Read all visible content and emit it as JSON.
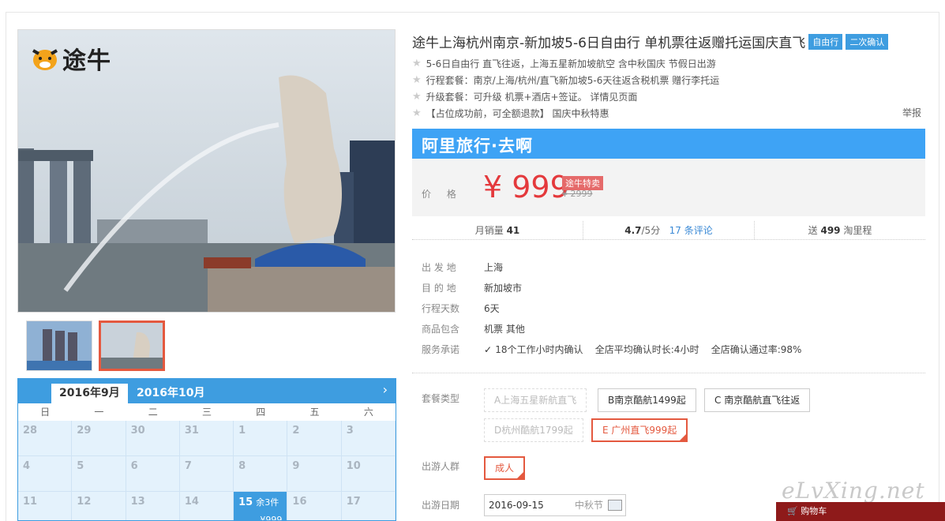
{
  "logo": {
    "text": "途牛"
  },
  "title": {
    "text": "途牛上海杭州南京-新加坡5-6日自由行 单机票往返赠托运国庆直飞",
    "badges": [
      "自由行",
      "二次确认"
    ]
  },
  "features": [
    "5-6日自由行 直飞往返，上海五星新加坡航空 含中秋国庆 节假日出游",
    "行程套餐：南京/上海/杭州/直飞新加坡5-6天往返含税机票 赠行李托运",
    "升级套餐：可升级 机票+酒店+签证。 详情见页面",
    "【占位成功前，可全额退款】 国庆中秋特惠"
  ],
  "report": "举报",
  "banner": "阿里旅行·去啊",
  "price": {
    "label": "价 格",
    "value": "¥ 999",
    "tag": "途牛特卖",
    "original": "¥ 2999"
  },
  "stats": {
    "sales_label": "月销量",
    "sales": "41",
    "rating": "4.7",
    "rating_suffix": "/5分",
    "reviews": "17 条评论",
    "points_prefix": "送",
    "points": "499",
    "points_suffix": "淘里程"
  },
  "details": [
    {
      "k": "出 发 地",
      "v": "上海"
    },
    {
      "k": "目 的 地",
      "v": "新加坡市"
    },
    {
      "k": "行程天数",
      "v": "6天"
    },
    {
      "k": "商品包含",
      "v": "机票  其他"
    },
    {
      "k": "服务承诺",
      "v": "18个工作小时内确认    全店平均确认时长:4小时    全店确认通过率:98%"
    }
  ],
  "package": {
    "label": "套餐类型",
    "options": [
      "A上海五星新航直飞",
      "B南京酷航1499起",
      "C 南京酷航直飞往返",
      "D杭州酷航1799起",
      "E 广州直飞999起"
    ]
  },
  "crowd": {
    "label": "出游人群",
    "option": "成人"
  },
  "date": {
    "label": "出游日期",
    "value": "2016-09-15",
    "festival": "中秋节"
  },
  "calendar": {
    "tabs": [
      "2016年9月",
      "2016年10月"
    ],
    "weekdays": [
      "日",
      "一",
      "二",
      "三",
      "四",
      "五",
      "六"
    ],
    "days": [
      "28",
      "29",
      "30",
      "31",
      "1",
      "2",
      "3",
      "4",
      "5",
      "6",
      "7",
      "8",
      "9",
      "10",
      "11",
      "12",
      "13",
      "14",
      "15",
      "16",
      "17"
    ],
    "selected": {
      "day": "15",
      "remaining": "余3件",
      "price": "¥999"
    }
  },
  "watermark": "eLvXing.net",
  "cart": "购物车"
}
